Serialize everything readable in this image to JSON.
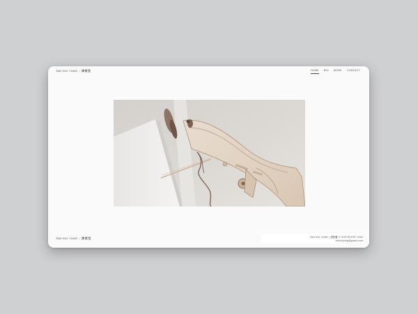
{
  "header": {
    "brand_name": "TAN HUI YUNG",
    "brand_sep": "|",
    "brand_cjk": "譚慧瑩",
    "nav": [
      {
        "label": "HOME",
        "active": true
      },
      {
        "label": "BIO",
        "active": false
      },
      {
        "label": "WORK",
        "active": false
      },
      {
        "label": "CONTACT",
        "active": false
      }
    ]
  },
  "hero": {
    "alt": "Laser-cut plywood mechanical sculpture mounted on a white wall"
  },
  "footer": {
    "brand_name": "TAN HUI YUNG",
    "brand_sep": "|",
    "brand_cjk": "譚慧瑩",
    "copyright": "TAN HUI YUNG | 譚慧瑩 © COPYRIGHT 2020",
    "email": "tanhuiyung@gmail.com"
  }
}
